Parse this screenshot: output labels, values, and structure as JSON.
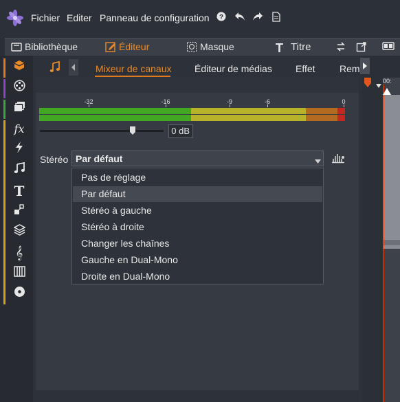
{
  "menu": {
    "file": "Fichier",
    "edit": "Editer",
    "control_panel": "Panneau de configuration"
  },
  "tabs": {
    "library": "Bibliothèque",
    "editor": "Éditeur",
    "mask": "Masque",
    "title": "Titre"
  },
  "subtabs": {
    "channel_mixer": "Mixeur de canaux",
    "media_editor": "Éditeur de médias",
    "effect": "Effet",
    "truncated": "Rem"
  },
  "meter": {
    "ticks": [
      "-32",
      "-16",
      "-9",
      "-6",
      "0"
    ],
    "gain_value": "0",
    "gain_unit": "dB"
  },
  "stereo": {
    "label": "Stéréo",
    "selected": "Par défaut",
    "options": [
      "Pas de réglage",
      "Par défaut",
      "Stéréo à gauche",
      "Stéréo à droite",
      "Changer les chaînes",
      "Gauche en Dual-Mono",
      "Droite en Dual-Mono"
    ],
    "highlighted_index": 1
  },
  "timeline": {
    "timecode": "00:"
  },
  "colors": {
    "accent": "#e07a1f",
    "meter_green": "#43a821",
    "meter_yellow": "#b6b22a",
    "meter_orange": "#b56a22",
    "meter_red": "#c4271f"
  }
}
